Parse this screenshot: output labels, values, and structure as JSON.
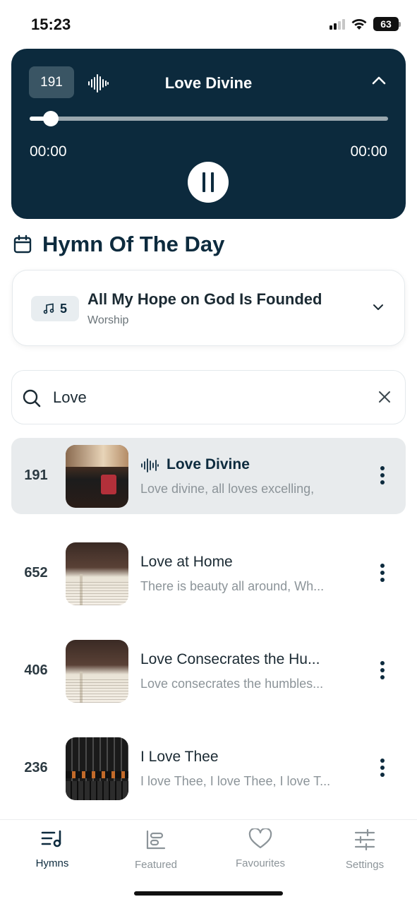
{
  "status_bar": {
    "time": "15:23",
    "battery": "63",
    "icons": [
      "signal-icon",
      "wifi-icon",
      "battery-icon"
    ]
  },
  "player": {
    "hymn_number": "191",
    "title": "Love Divine",
    "elapsed": "00:00",
    "duration": "00:00",
    "progress": 0.06,
    "icons": [
      "waveform-icon",
      "chevron-up-icon",
      "pause-icon"
    ]
  },
  "hymn_of_the_day": {
    "heading": "Hymn Of The Day",
    "number": "5",
    "title": "All My Hope on God Is Founded",
    "category": "Worship",
    "icons": [
      "calendar-icon",
      "music-note-icon",
      "chevron-down-icon"
    ]
  },
  "search": {
    "value": "Love",
    "icons": [
      "search-icon",
      "close-icon"
    ]
  },
  "hymns": [
    {
      "number": "191",
      "title": "Love Divine",
      "snippet": "Love divine, all loves excelling,",
      "playing": true
    },
    {
      "number": "652",
      "title": "Love at Home",
      "snippet": "There is beauty all around, Wh...",
      "playing": false
    },
    {
      "number": "406",
      "title": "Love Consecrates the Hu...",
      "snippet": "Love consecrates the humbles...",
      "playing": false
    },
    {
      "number": "236",
      "title": "I Love Thee",
      "snippet": "I love Thee, I love Thee, I love T...",
      "playing": false
    }
  ],
  "tabs": [
    {
      "label": "Hymns",
      "icon": "hymns-icon",
      "active": true
    },
    {
      "label": "Featured",
      "icon": "featured-icon",
      "active": false
    },
    {
      "label": "Favourites",
      "icon": "heart-icon",
      "active": false
    },
    {
      "label": "Settings",
      "icon": "sliders-icon",
      "active": false
    }
  ],
  "colors": {
    "primary": "#0c2a3d",
    "active_row": "#e8ebed",
    "muted_text": "#8c9499"
  }
}
